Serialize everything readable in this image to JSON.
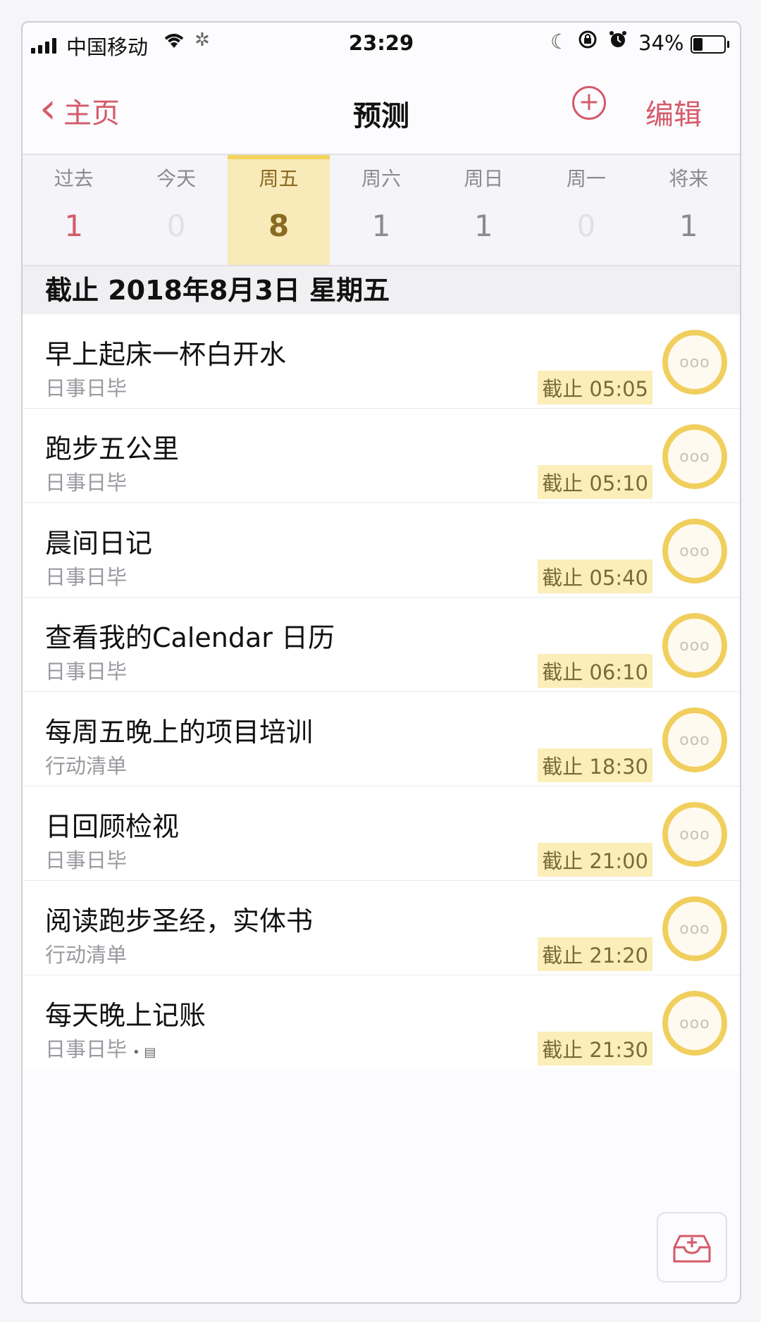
{
  "status_bar": {
    "carrier": "中国移动",
    "time": "23:29",
    "battery_percent": "34%",
    "battery_level": 0.34,
    "icons": [
      "signal-icon",
      "wifi-icon",
      "activity-spinner-icon",
      "do-not-disturb-moon-icon",
      "orientation-lock-icon",
      "alarm-icon",
      "battery-icon"
    ]
  },
  "nav": {
    "back_label": "主页",
    "title": "预测",
    "add_symbol": "+",
    "edit_label": "编辑"
  },
  "colors": {
    "accent": "#d45a6a",
    "highlight": "#f9eab9",
    "ring": "#f1cf5e"
  },
  "days": [
    {
      "label": "过去",
      "count": "1",
      "state": "overdue"
    },
    {
      "label": "今天",
      "count": "0",
      "state": "zero"
    },
    {
      "label": "周五",
      "count": "8",
      "state": "selected"
    },
    {
      "label": "周六",
      "count": "1",
      "state": "normal"
    },
    {
      "label": "周日",
      "count": "1",
      "state": "normal"
    },
    {
      "label": "周一",
      "count": "0",
      "state": "zero"
    },
    {
      "label": "将来",
      "count": "1",
      "state": "normal"
    }
  ],
  "section_header": "截止 2018年8月3日 星期五",
  "tasks": [
    {
      "title": "早上起床一杯白开水",
      "list": "日事日毕",
      "deadline": "截止 05:05",
      "more": "ooo"
    },
    {
      "title": "跑步五公里",
      "list": "日事日毕",
      "deadline": "截止 05:10",
      "more": "ooo"
    },
    {
      "title": "晨间日记",
      "list": "日事日毕",
      "deadline": "截止 05:40",
      "more": "ooo"
    },
    {
      "title": "查看我的Calendar 日历",
      "list": "日事日毕",
      "deadline": "截止 06:10",
      "more": "ooo"
    },
    {
      "title": "每周五晚上的项目培训",
      "list": "行动清单",
      "deadline": "截止 18:30",
      "more": "ooo"
    },
    {
      "title": "日回顾检视",
      "list": "日事日毕",
      "deadline": "截止 21:00",
      "more": "ooo"
    },
    {
      "title": "阅读跑步圣经，实体书",
      "list": "行动清单",
      "deadline": "截止 21:20",
      "more": "ooo"
    },
    {
      "title": "每天晚上记账",
      "list": "日事日毕",
      "deadline": "截止 21:30",
      "more": "ooo",
      "note_icon": "• ▤"
    }
  ]
}
